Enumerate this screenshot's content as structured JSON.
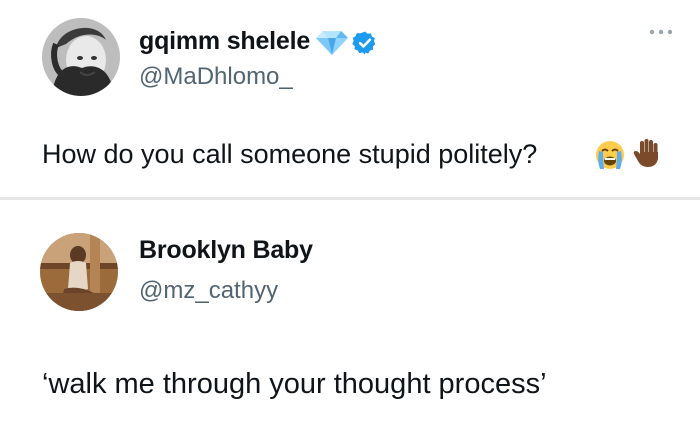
{
  "tweets": [
    {
      "display_name": "gqimm shelele",
      "handle": "@MaDhlomo_",
      "name_emoji_icon": "blue-diamond-icon",
      "verified_badge_icon": "verified-badge-icon",
      "more_icon": "more-dots-icon",
      "text": "How do you call someone stupid politely?",
      "text_emojis": [
        "crying-face-emoji-icon",
        "raised-hand-emoji-icon"
      ]
    },
    {
      "display_name": "Brooklyn Baby",
      "handle": "@mz_cathyy",
      "text": "‘walk me through your thought process’"
    }
  ],
  "colors": {
    "handle_gray": "#536471",
    "verified_blue": "#1d9bf0",
    "divider": "#e6e6e6",
    "text": "#0f1419"
  }
}
